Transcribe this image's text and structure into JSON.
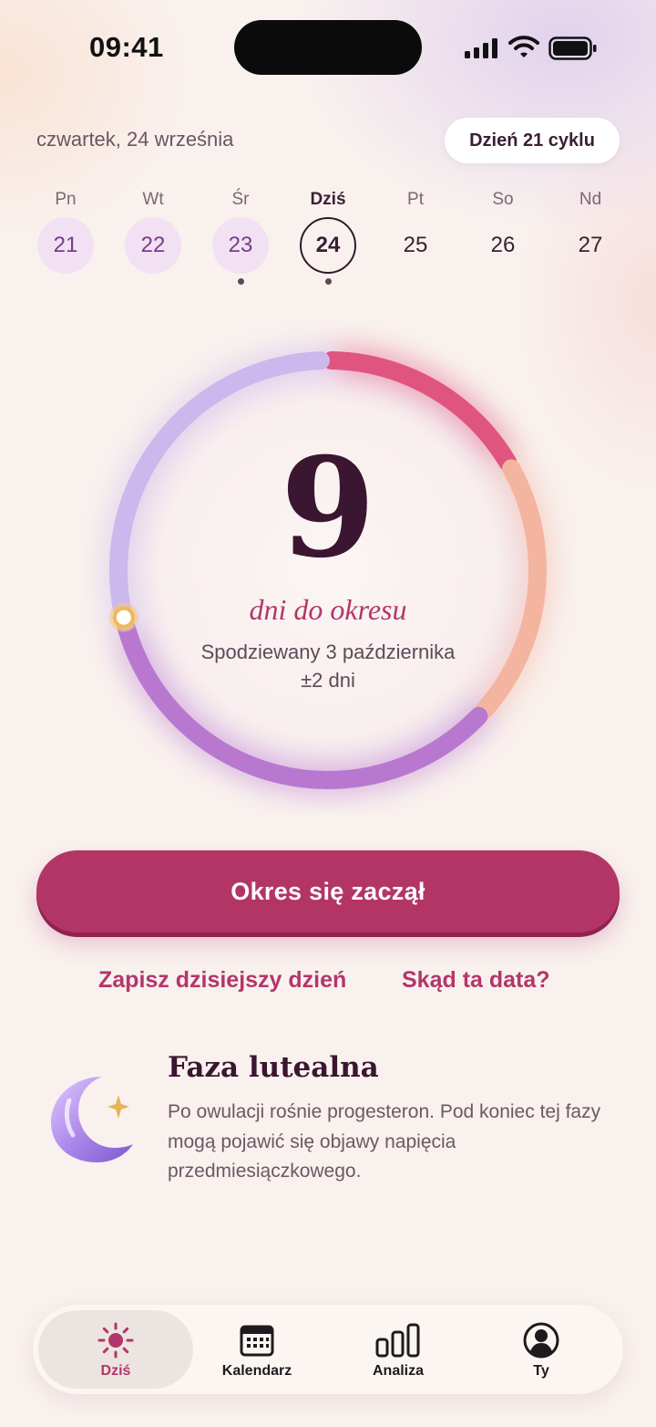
{
  "status_bar": {
    "time": "09:41"
  },
  "header": {
    "date": "czwartek, 24 września",
    "cycle_day": "Dzień 21 cyklu"
  },
  "week": [
    {
      "name": "Pn",
      "num": "21",
      "state": "past",
      "dot": false
    },
    {
      "name": "Wt",
      "num": "22",
      "state": "past",
      "dot": false
    },
    {
      "name": "Śr",
      "num": "23",
      "state": "past",
      "dot": true
    },
    {
      "name": "Dziś",
      "num": "24",
      "state": "today",
      "dot": true
    },
    {
      "name": "Pt",
      "num": "25",
      "state": "future",
      "dot": false
    },
    {
      "name": "So",
      "num": "26",
      "state": "future",
      "dot": false
    },
    {
      "name": "Nd",
      "num": "27",
      "state": "future",
      "dot": false
    }
  ],
  "countdown": {
    "days": "9",
    "label": "dni do okresu",
    "expected": "Spodziewany 3 października",
    "tolerance": "±2 dni"
  },
  "actions": {
    "primary": "Okres się zaczął",
    "log_today": "Zapisz dzisiejszy dzień",
    "why_date": "Skąd ta data?"
  },
  "phase": {
    "icon": "moon-icon",
    "title": "Faza lutealna",
    "description": "Po owulacji rośnie progesteron. Pod koniec tej fazy mogą pojawić się objawy napięcia przedmiesiączkowego."
  },
  "tabs": [
    {
      "label": "Dziś",
      "icon": "sun-icon",
      "active": true
    },
    {
      "label": "Kalendarz",
      "icon": "calendar-icon",
      "active": false
    },
    {
      "label": "Analiza",
      "icon": "bar-chart-icon",
      "active": false
    },
    {
      "label": "Ty",
      "icon": "profile-icon",
      "active": false
    }
  ],
  "colors": {
    "accent": "#b33566",
    "period": "#e05580",
    "fertile": "#f3b4a0",
    "luteal": "#b878d0",
    "upcoming": "#cbb8ec"
  }
}
